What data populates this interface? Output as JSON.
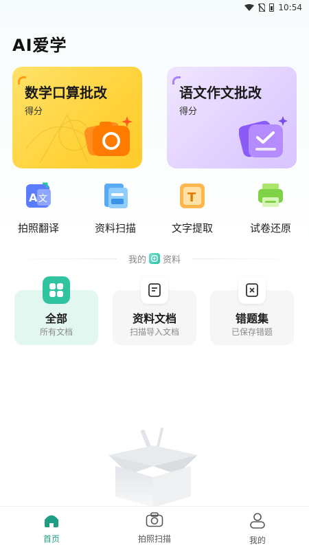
{
  "status_bar": {
    "time": "10:54"
  },
  "app": {
    "title": "AI爱学"
  },
  "cards": [
    {
      "title": "数学口算批改",
      "subtitle": "得分",
      "icon": "camera-icon"
    },
    {
      "title": "语文作文批改",
      "subtitle": "得分",
      "icon": "check-doc-icon"
    }
  ],
  "tools": [
    {
      "label": "拍照翻译",
      "icon": "translate-icon"
    },
    {
      "label": "资料扫描",
      "icon": "scan-icon"
    },
    {
      "label": "文字提取",
      "icon": "text-extract-icon"
    },
    {
      "label": "试卷还原",
      "icon": "printer-icon"
    }
  ],
  "my_files": {
    "prefix": "我的",
    "suffix": "资料"
  },
  "doc_categories": [
    {
      "title": "全部",
      "subtitle": "所有文档",
      "icon": "grid-icon"
    },
    {
      "title": "资料文档",
      "subtitle": "扫描导入文档",
      "icon": "document-icon"
    },
    {
      "title": "错题集",
      "subtitle": "已保存错题",
      "icon": "wrong-question-icon"
    }
  ],
  "bottom_nav": [
    {
      "label": "首页",
      "icon": "home-icon"
    },
    {
      "label": "拍照扫描",
      "icon": "camera-icon"
    },
    {
      "label": "我的",
      "icon": "profile-icon"
    }
  ],
  "colors": {
    "accent": "#1f9e84",
    "math_card": "#ffd23a",
    "chinese_card": "#e2d2ff"
  }
}
